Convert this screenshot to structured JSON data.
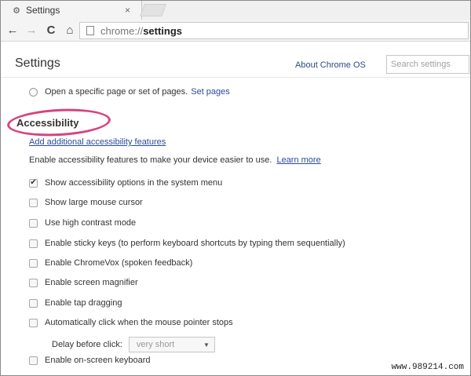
{
  "tab": {
    "title": "Settings",
    "close": "×"
  },
  "toolbar": {
    "back": "←",
    "forward": "→",
    "reload": "C",
    "home": "⌂",
    "url_scheme": "chrome://",
    "url_path": "settings"
  },
  "header": {
    "title": "Settings",
    "about_link": "About Chrome OS",
    "search_placeholder": "Search settings"
  },
  "startup": {
    "option_label": "Open a specific page or set of pages.",
    "set_pages_link": "Set pages"
  },
  "accessibility": {
    "title": "Accessibility",
    "add_features_link": "Add additional accessibility features",
    "description": "Enable accessibility features to make your device easier to use.",
    "learn_more": "Learn more",
    "options": [
      {
        "label": "Show accessibility options in the system menu",
        "checked": true
      },
      {
        "label": "Show large mouse cursor",
        "checked": false
      },
      {
        "label": "Use high contrast mode",
        "checked": false
      },
      {
        "label": "Enable sticky keys (to perform keyboard shortcuts by typing them sequentially)",
        "checked": false
      },
      {
        "label": "Enable ChromeVox (spoken feedback)",
        "checked": false
      },
      {
        "label": "Enable screen magnifier",
        "checked": false
      },
      {
        "label": "Enable tap dragging",
        "checked": false
      },
      {
        "label": "Automatically click when the mouse pointer stops",
        "checked": false
      },
      {
        "label": "Enable on-screen keyboard",
        "checked": false
      }
    ],
    "delay_label": "Delay before click:",
    "delay_value": "very short"
  },
  "checkmark": "✔",
  "watermark": "www.989214.com",
  "colors": {
    "highlight": "#d8437e",
    "link": "#2a4a9a"
  }
}
